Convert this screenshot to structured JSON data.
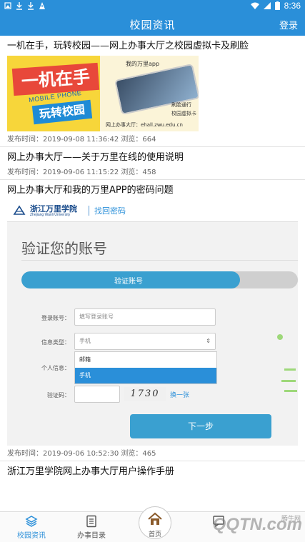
{
  "status_bar": {
    "time": "8:36",
    "left_icons": [
      "image-icon",
      "download-icon",
      "download-icon",
      "alert-icon"
    ],
    "right_icons": [
      "wifi-icon",
      "signal-icon",
      "battery-icon"
    ]
  },
  "header": {
    "title": "校园资讯",
    "login_label": "登录"
  },
  "articles": [
    {
      "title": "一机在手，玩转校园——网上办事大厅之校园虚拟卡及刷脸",
      "meta": "发布时间：2019-09-08 11:36:42 浏览：664",
      "banner": {
        "main": "一机在手",
        "sub": "MOBILE PHONE",
        "sub2": "玩转校园",
        "cap1": "我的万里app",
        "cap2": "刷脸通行",
        "cap3": "校园虚拟卡",
        "cap4": "网上办事大厅：ehall.zwu.edu.cn",
        "colors": {
          "bg": "#f7d63a",
          "red": "#e8483a",
          "blue": "#1e8bd6"
        }
      }
    },
    {
      "title": "网上办事大厅——关于万里在线的使用说明",
      "meta": "发布时间：2019-09-06 11:15:22 浏览：458"
    },
    {
      "title": "网上办事大厅和我的万里APP的密码问题",
      "meta": "发布时间：2019-09-06 10:52:30 浏览：465",
      "banner": {
        "school": "浙江万里学院",
        "school_en": "Zhejiang Wanli University",
        "find_password": "找回密码",
        "heading": "验证您的账号",
        "progress_label": "验证账号",
        "progress_fraction": 0.79,
        "fields": [
          {
            "label": "登录账号：",
            "placeholder": "填写登录账号"
          },
          {
            "label": "信息类型：",
            "value": "手机"
          },
          {
            "label": "个人信息："
          },
          {
            "label": "验证码："
          }
        ],
        "dropdown_options": [
          "邮箱",
          "手机"
        ],
        "dropdown_selected": "手机",
        "captcha": "1730",
        "change_label": "换一张",
        "next_label": "下一步"
      }
    },
    {
      "title": "浙江万里学院网上办事大厅用户操作手册"
    }
  ],
  "bottom_nav": {
    "items": [
      {
        "label": "校园资讯",
        "icon": "layers-icon",
        "active": true
      },
      {
        "label": "办事目录",
        "icon": "list-icon",
        "active": false
      },
      {
        "label": "首页",
        "icon": "home-icon",
        "active": false
      },
      {
        "label": "",
        "icon": "message-icon",
        "active": false
      }
    ],
    "watermark": "QQTN.com",
    "watermark_sub": "腾牛网"
  },
  "colors": {
    "primary": "#2a8fd9",
    "accent": "#3aa0d0"
  }
}
